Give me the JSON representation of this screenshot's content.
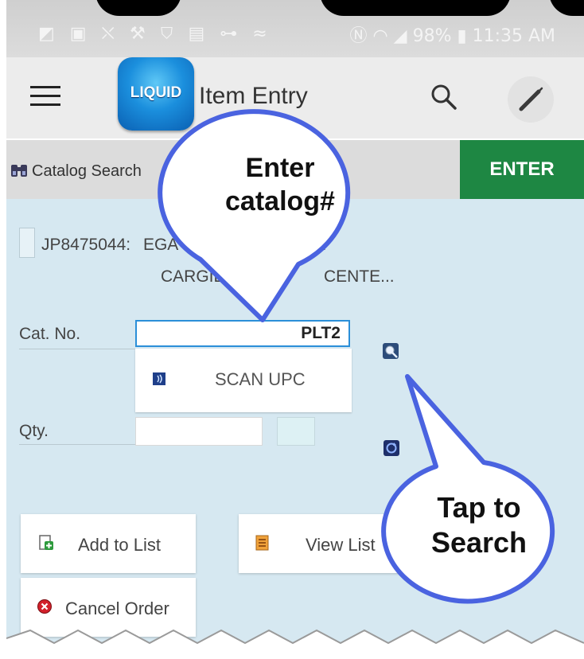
{
  "status_bar": {
    "icons_left": "◩ ▣ ⛌ ⚒ ⛉ ▤ ⊶ ≈",
    "right_text": "Ⓝ ◠ ◢ 98% ▮ 11:35 AM"
  },
  "app_bar": {
    "logo_text": "LIQUID",
    "title": "Item Entry"
  },
  "catalog_bar": {
    "search_label": "Catalog Search",
    "enter_label": "ENTER"
  },
  "order": {
    "account_id": "JP8475044:",
    "account_line1": "EGA",
    "account_line1_tail": "E...",
    "account_line2": "CARGILL",
    "account_line2_tail": "CENTE..."
  },
  "form": {
    "cat_no_label": "Cat. No.",
    "cat_no_value": "PLT2",
    "scan_upc_label": "SCAN UPC",
    "qty_label": "Qty.",
    "qty_value": ""
  },
  "buttons": {
    "add_to_list": "Add to List",
    "view_list": "View List",
    "cancel_order": "Cancel Order"
  },
  "callouts": {
    "enter_catalog_line1": "Enter",
    "enter_catalog_line2": "catalog#",
    "tap_search_line1": "Tap to",
    "tap_search_line2": "Search"
  },
  "colors": {
    "enter_button": "#1e8743",
    "content_background": "#d6e8f1",
    "callout_border": "#4a63e0",
    "input_focus": "#2b8fd8"
  }
}
